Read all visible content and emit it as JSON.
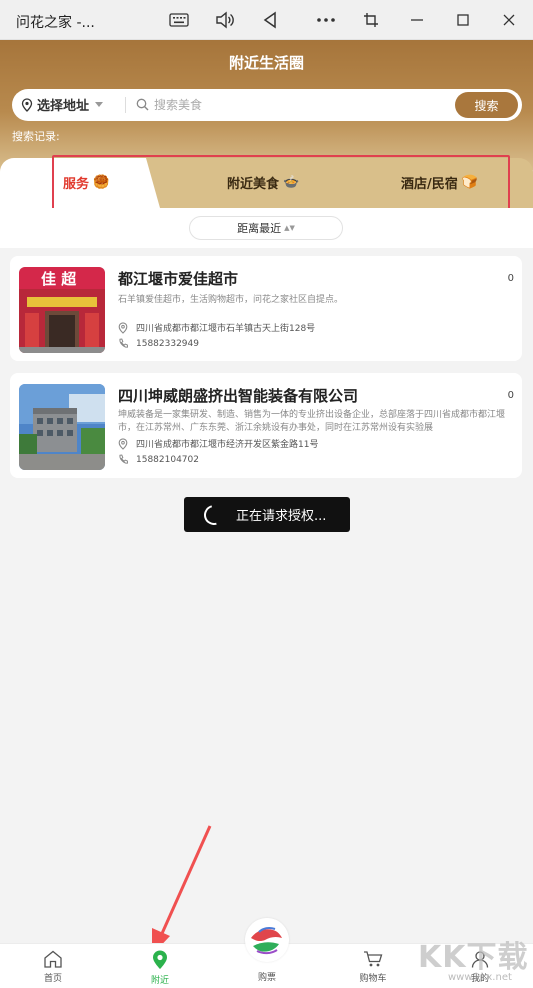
{
  "window": {
    "title": "问花之家 -...",
    "controls": [
      "keyboard-icon",
      "volume-icon",
      "back-icon",
      "more-icon",
      "screenshot-icon",
      "minimize-icon",
      "maximize-icon",
      "close-icon"
    ]
  },
  "header": {
    "title": "附近生活圈",
    "address_label": "选择地址",
    "search_placeholder": "搜索美食",
    "search_button": "搜索",
    "history_label": "搜索记录:"
  },
  "tabs": [
    {
      "label": "服务",
      "emoji": "🥮",
      "active": true
    },
    {
      "label": "附近美食",
      "emoji": "🍲",
      "active": false
    },
    {
      "label": "酒店/民宿",
      "emoji": "🍞",
      "active": false
    }
  ],
  "sort": {
    "label": "距离最近",
    "indicator": "▲▼"
  },
  "listings": [
    {
      "name": "都江堰市爱佳超市",
      "count": "0",
      "description": "石羊镇爱佳超市，生活购物超市，问花之家社区自提点。",
      "address": "四川省成都市都江堰市石羊镇古天上街128号",
      "phone": "15882332949",
      "thumb_sign": "佳 超"
    },
    {
      "name": "四川坤威朗盛挤出智能装备有限公司",
      "count": "0",
      "description": "坤威装备是一家集研发、制造、销售为一体的专业挤出设备企业，总部座落于四川省成都市都江堰市，在江苏常州、广东东莞、浙江余姚设有办事处，同时在江苏常州设有实验展",
      "address": "四川省成都市都江堰市经济开发区紫金路11号",
      "phone": "15882104702"
    }
  ],
  "toast": {
    "text": "正在请求授权..."
  },
  "nav": [
    {
      "label": "首页",
      "icon": "home-icon",
      "active": false
    },
    {
      "label": "附近",
      "icon": "location-pin-icon",
      "active": true
    },
    {
      "label": "购票",
      "icon": "logo-icon",
      "active": false
    },
    {
      "label": "购物车",
      "icon": "cart-icon",
      "active": false
    },
    {
      "label": "我的",
      "icon": "user-icon",
      "active": false
    }
  ],
  "watermark": {
    "text": "KK下载",
    "sub": "www.kkx.net"
  },
  "colors": {
    "accent": "#a9773d",
    "active_tab": "#e13a2e",
    "nav_active": "#2bb24c",
    "highlight": "#e0404f",
    "arrow": "#f05050"
  }
}
